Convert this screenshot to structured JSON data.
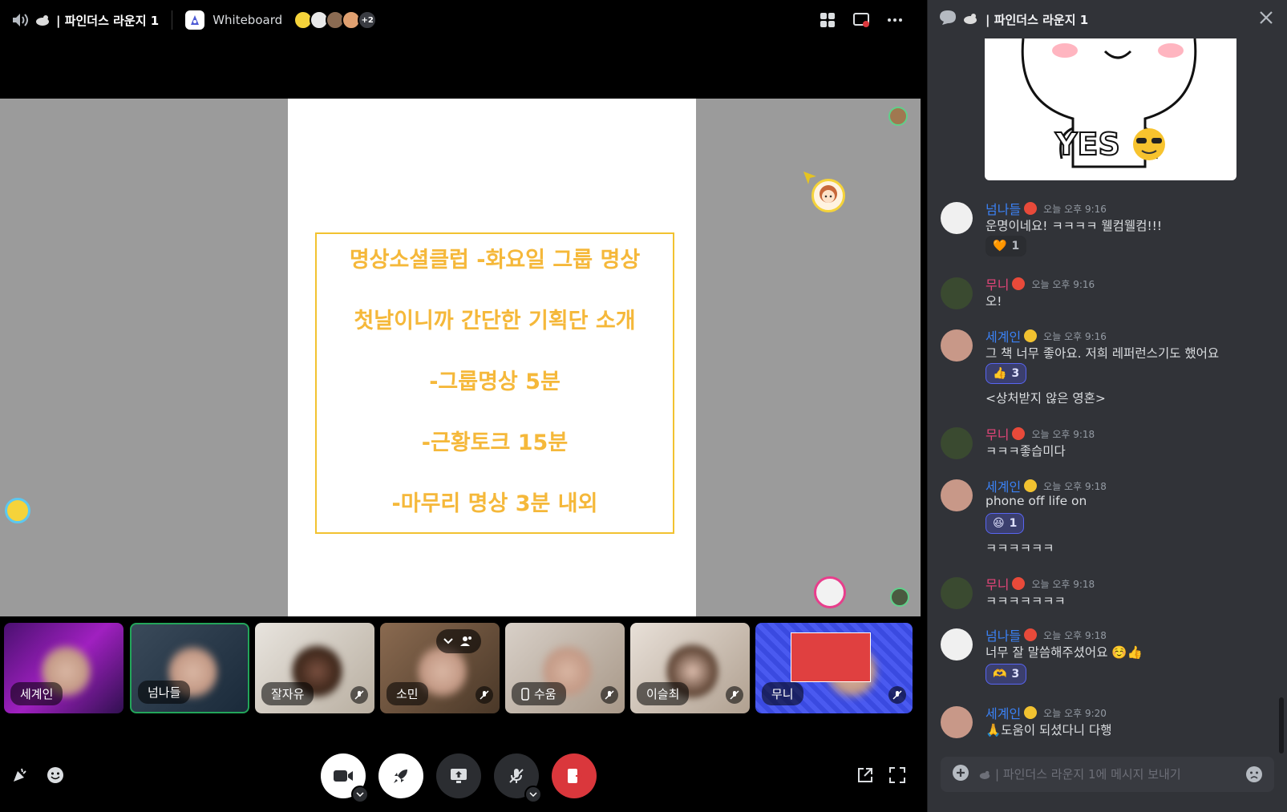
{
  "call": {
    "channel_title": "파인더스 라운지 1",
    "activity_label": "Whiteboard",
    "more_count": "+2"
  },
  "whiteboard": {
    "lines": [
      "명상소셜클럽 -화요일 그룹 명상",
      "첫날이니까 간단한 기획단 소개",
      "-그룹명상 5분",
      "-근황토크 15분",
      "-마무리 명상 3분 내외"
    ]
  },
  "participants": [
    {
      "name": "세계인",
      "muted": false
    },
    {
      "name": "넘나들",
      "muted": false,
      "speaking": true
    },
    {
      "name": "잘자유",
      "muted": true
    },
    {
      "name": "소민",
      "muted": true
    },
    {
      "name": "수움",
      "muted": true,
      "mobile": true
    },
    {
      "name": "이슬최",
      "muted": true
    },
    {
      "name": "무니",
      "muted": true
    }
  ],
  "chat": {
    "title": "파인더스 라운지 1",
    "input_placeholder": "| 파인더스 라운지 1에 메시지 보내기",
    "sticker_text": "YES",
    "messages": [
      {
        "user": "넘나들",
        "color": "#3b82f6",
        "time": "오늘 오후 9:16",
        "text": "운명이네요! ㅋㅋㅋㅋ 웰컴웰컴!!!",
        "reaction": {
          "emoji": "🧡",
          "count": "1"
        }
      },
      {
        "user": "무니",
        "color": "#e8457a",
        "time": "오늘 오후 9:16",
        "text": "오!"
      },
      {
        "user": "세계인",
        "color": "#3b82f6",
        "time": "오늘 오후 9:16",
        "text": "그 책 너무 좋아요. 저희 레퍼런스기도 했어요",
        "reaction": {
          "emoji": "👍",
          "count": "3"
        },
        "text2": "<상처받지 않은 영혼>"
      },
      {
        "user": "무니",
        "color": "#e8457a",
        "time": "오늘 오후 9:18",
        "text": "ㅋㅋㅋ좋습미다"
      },
      {
        "user": "세계인",
        "color": "#3b82f6",
        "time": "오늘 오후 9:18",
        "text": "phone off life on",
        "reaction": {
          "emoji": "😆",
          "count": "1"
        },
        "text2": "ㅋㅋㅋㅋㅋㅋ"
      },
      {
        "user": "무니",
        "color": "#e8457a",
        "time": "오늘 오후 9:18",
        "text": "ㅋㅋㅋㅋㅋㅋㅋ"
      },
      {
        "user": "넘나들",
        "color": "#3b82f6",
        "time": "오늘 오후 9:18",
        "text": "너무 잘 말씀해주셨어요 ☺️👍",
        "reaction": {
          "emoji": "🫶",
          "count": "3"
        }
      },
      {
        "user": "세계인",
        "color": "#3b82f6",
        "time": "오늘 오후 9:20",
        "text": "🙏도움이 되셨다니 다행"
      }
    ]
  },
  "colors": {
    "accent": "#5865f2",
    "danger": "#da373c",
    "whiteboard_text": "#f5b83a",
    "speaking_border": "#23a55a"
  }
}
